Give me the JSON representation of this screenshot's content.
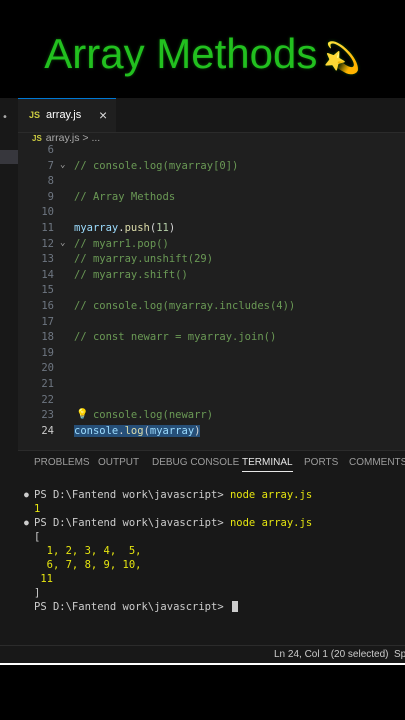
{
  "overlay_title": {
    "text": "Array Methods",
    "emoji": "💫"
  },
  "tab": {
    "icon": "JS",
    "label": "array.js",
    "close": "×"
  },
  "breadcrumb": {
    "icon": "JS",
    "file": "array.js",
    "sep": ">",
    "rest": "..."
  },
  "code_lines": [
    {
      "num": "6",
      "segments": []
    },
    {
      "num": "7",
      "fold": "⌄",
      "segments": [
        {
          "t": "// console.log(myarray[0])",
          "c": "cmt"
        }
      ]
    },
    {
      "num": "8",
      "segments": []
    },
    {
      "num": "9",
      "segments": [
        {
          "t": "// Array Methods",
          "c": "cmt"
        }
      ]
    },
    {
      "num": "10",
      "segments": []
    },
    {
      "num": "11",
      "segments": [
        {
          "t": "myarray",
          "c": "id"
        },
        {
          "t": ".",
          "c": "plain"
        },
        {
          "t": "push",
          "c": "fn"
        },
        {
          "t": "(",
          "c": "plain"
        },
        {
          "t": "11",
          "c": "num"
        },
        {
          "t": ")",
          "c": "plain"
        }
      ]
    },
    {
      "num": "12",
      "fold": "⌄",
      "segments": [
        {
          "t": "// myarr1.pop()",
          "c": "cmt"
        }
      ]
    },
    {
      "num": "13",
      "segments": [
        {
          "t": "// myarray.unshift(29)",
          "c": "cmt"
        }
      ]
    },
    {
      "num": "14",
      "segments": [
        {
          "t": "// myarray.shift()",
          "c": "cmt"
        }
      ]
    },
    {
      "num": "15",
      "segments": []
    },
    {
      "num": "16",
      "segments": [
        {
          "t": "// console.log(myarray.includes(4))",
          "c": "cmt"
        }
      ]
    },
    {
      "num": "17",
      "segments": []
    },
    {
      "num": "18",
      "segments": [
        {
          "t": "// const newarr = myarray.join()",
          "c": "cmt"
        }
      ]
    },
    {
      "num": "19",
      "segments": []
    },
    {
      "num": "20",
      "segments": []
    },
    {
      "num": "21",
      "segments": []
    },
    {
      "num": "22",
      "segments": []
    },
    {
      "num": "23",
      "bulb": "💡",
      "segments": [
        {
          "t": "   console.log(newarr)",
          "c": "cmt"
        }
      ]
    },
    {
      "num": "24",
      "active": true,
      "segments": [
        {
          "t": "console",
          "c": "id sel"
        },
        {
          "t": ".",
          "c": "plain sel"
        },
        {
          "t": "log",
          "c": "fn sel"
        },
        {
          "t": "(",
          "c": "plain sel"
        },
        {
          "t": "myarray",
          "c": "id sel"
        },
        {
          "t": ")",
          "c": "plain sel"
        }
      ]
    }
  ],
  "panel_tabs": [
    "PROBLEMS",
    "OUTPUT",
    "DEBUG CONSOLE",
    "TERMINAL",
    "PORTS",
    "COMMENTS"
  ],
  "active_panel_tab": "TERMINAL",
  "terminal_lines": [
    {
      "dot": true,
      "prompt": "PS D:\\Fantend work\\javascript> ",
      "cmd": "node array.js"
    },
    {
      "text": "1",
      "yellow": true
    },
    {
      "dot": true,
      "prompt": "PS D:\\Fantend work\\javascript> ",
      "cmd": "node array.js"
    },
    {
      "text": "["
    },
    {
      "text": "  1, 2, 3, 4,  5,",
      "yellow": true
    },
    {
      "text": "  6, 7, 8, 9, 10,",
      "yellow": true
    },
    {
      "text": " 11",
      "yellow": true
    },
    {
      "text": "]"
    },
    {
      "prompt": "PS D:\\Fantend work\\javascript> ",
      "cursor": true
    }
  ],
  "status": {
    "position": "Ln 24, Col 1 (20 selected)",
    "right": "Sp"
  }
}
